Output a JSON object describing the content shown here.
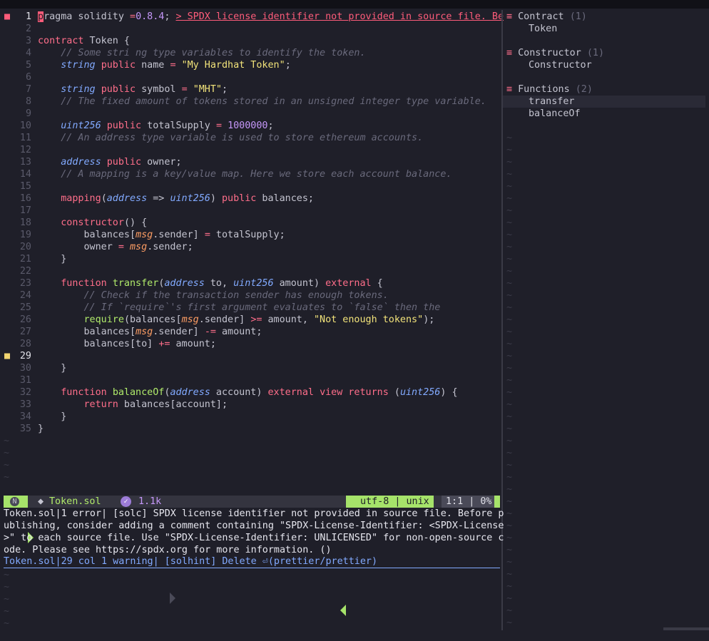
{
  "editor": {
    "virtual_error": "> SPDX license identifier not provided in source file. Be",
    "tilde": "~"
  },
  "outline": {
    "groups": [
      {
        "glyph": "≡",
        "label": "Contract",
        "count": "(1)",
        "items": [
          "Token"
        ]
      },
      {
        "glyph": "≡",
        "label": "Constructor",
        "count": "(1)",
        "items": [
          "Constructor"
        ]
      },
      {
        "glyph": "≡",
        "label": "Functions",
        "count": "(2)",
        "items": [
          "transfer",
          "balanceOf"
        ]
      }
    ]
  },
  "statusline": {
    "mode": "N",
    "filename": "Token.sol",
    "size": "1.1k",
    "encoding": "utf-8 | unix",
    "position": "1:1 | 0%"
  },
  "messages": [
    "Token.sol|1 error| [solc] SPDX license identifier not provided in source file. Before p",
    "ublishing, consider adding a comment containing \"SPDX-License-Identifier: <SPDX-License",
    ">\" to each source file. Use \"SPDX-License-Identifier: UNLICENSED\" for non-open-source c",
    "ode. Please see https://spdx.org for more information. ()"
  ],
  "quickfix": "Token.sol|29 col 1 warning| [solhint] Delete ⏎(prettier/prettier)",
  "colors": {
    "background": "#1f1f29",
    "keyword": "#ff6e8a",
    "type": "#82aaff",
    "function": "#b0ea6a",
    "string": "#f2e37a",
    "number": "#c597f9",
    "mode_accent": "#a6e36a"
  },
  "code_lines": [
    "pragma solidity =0.8.4;",
    "",
    "contract Token {",
    "    // Some stri ng type variables to identify the token.",
    "    string public name = \"My Hardhat Token\";",
    "",
    "    string public symbol = \"MHT\";",
    "    // The fixed amount of tokens stored in an unsigned integer type variable.",
    "",
    "    uint256 public totalSupply = 1000000;",
    "    // An address type variable is used to store ethereum accounts.",
    "",
    "    address public owner;",
    "    // A mapping is a key/value map. Here we store each account balance.",
    "",
    "    mapping(address => uint256) public balances;",
    "",
    "    constructor() {",
    "        balances[msg.sender] = totalSupply;",
    "        owner = msg.sender;",
    "    }",
    "",
    "    function transfer(address to, uint256 amount) external {",
    "        // Check if the transaction sender has enough tokens.",
    "        // If `require`'s first argument evaluates to `false` then the",
    "        require(balances[msg.sender] >= amount, \"Not enough tokens\");",
    "        balances[msg.sender] -= amount;",
    "        balances[to] += amount;",
    "",
    "    }",
    "",
    "    function balanceOf(address account) external view returns (uint256) {",
    "        return balances[account];",
    "    }",
    "}"
  ]
}
